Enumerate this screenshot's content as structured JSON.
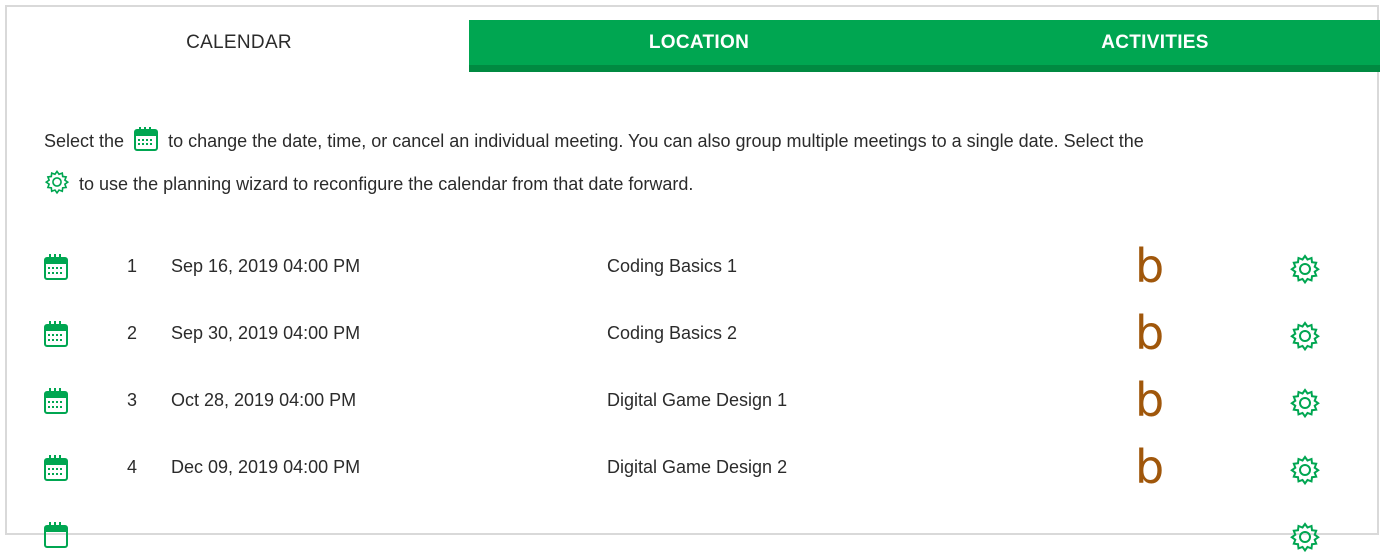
{
  "tabs": [
    {
      "label": "CALENDAR",
      "active": true
    },
    {
      "label": "LOCATION",
      "active": false
    },
    {
      "label": "ACTIVITIES",
      "active": false
    }
  ],
  "instructions": {
    "part1": "Select the",
    "part2": "to change the date, time, or cancel an individual meeting. You can also group multiple meetings to a single date. Select the",
    "part3": "to use the planning wizard to reconfigure the calendar from that date forward."
  },
  "meetings": [
    {
      "number": "1",
      "datetime": "Sep 16, 2019 04:00 PM",
      "title": "Coding Basics 1",
      "marker": "b"
    },
    {
      "number": "2",
      "datetime": "Sep 30, 2019 04:00 PM",
      "title": "Coding Basics 2",
      "marker": "b"
    },
    {
      "number": "3",
      "datetime": "Oct 28, 2019 04:00 PM",
      "title": "Digital Game Design 1",
      "marker": "b"
    },
    {
      "number": "4",
      "datetime": "Dec 09, 2019 04:00 PM",
      "title": "Digital Game Design 2",
      "marker": "b"
    }
  ],
  "colors": {
    "brand_green": "#00a651",
    "brand_green_dark": "#008a41",
    "marker_brown": "#a0570b",
    "text": "#2b2b2b"
  },
  "icons": {
    "calendar": "calendar-icon",
    "settings": "gear-icon"
  }
}
